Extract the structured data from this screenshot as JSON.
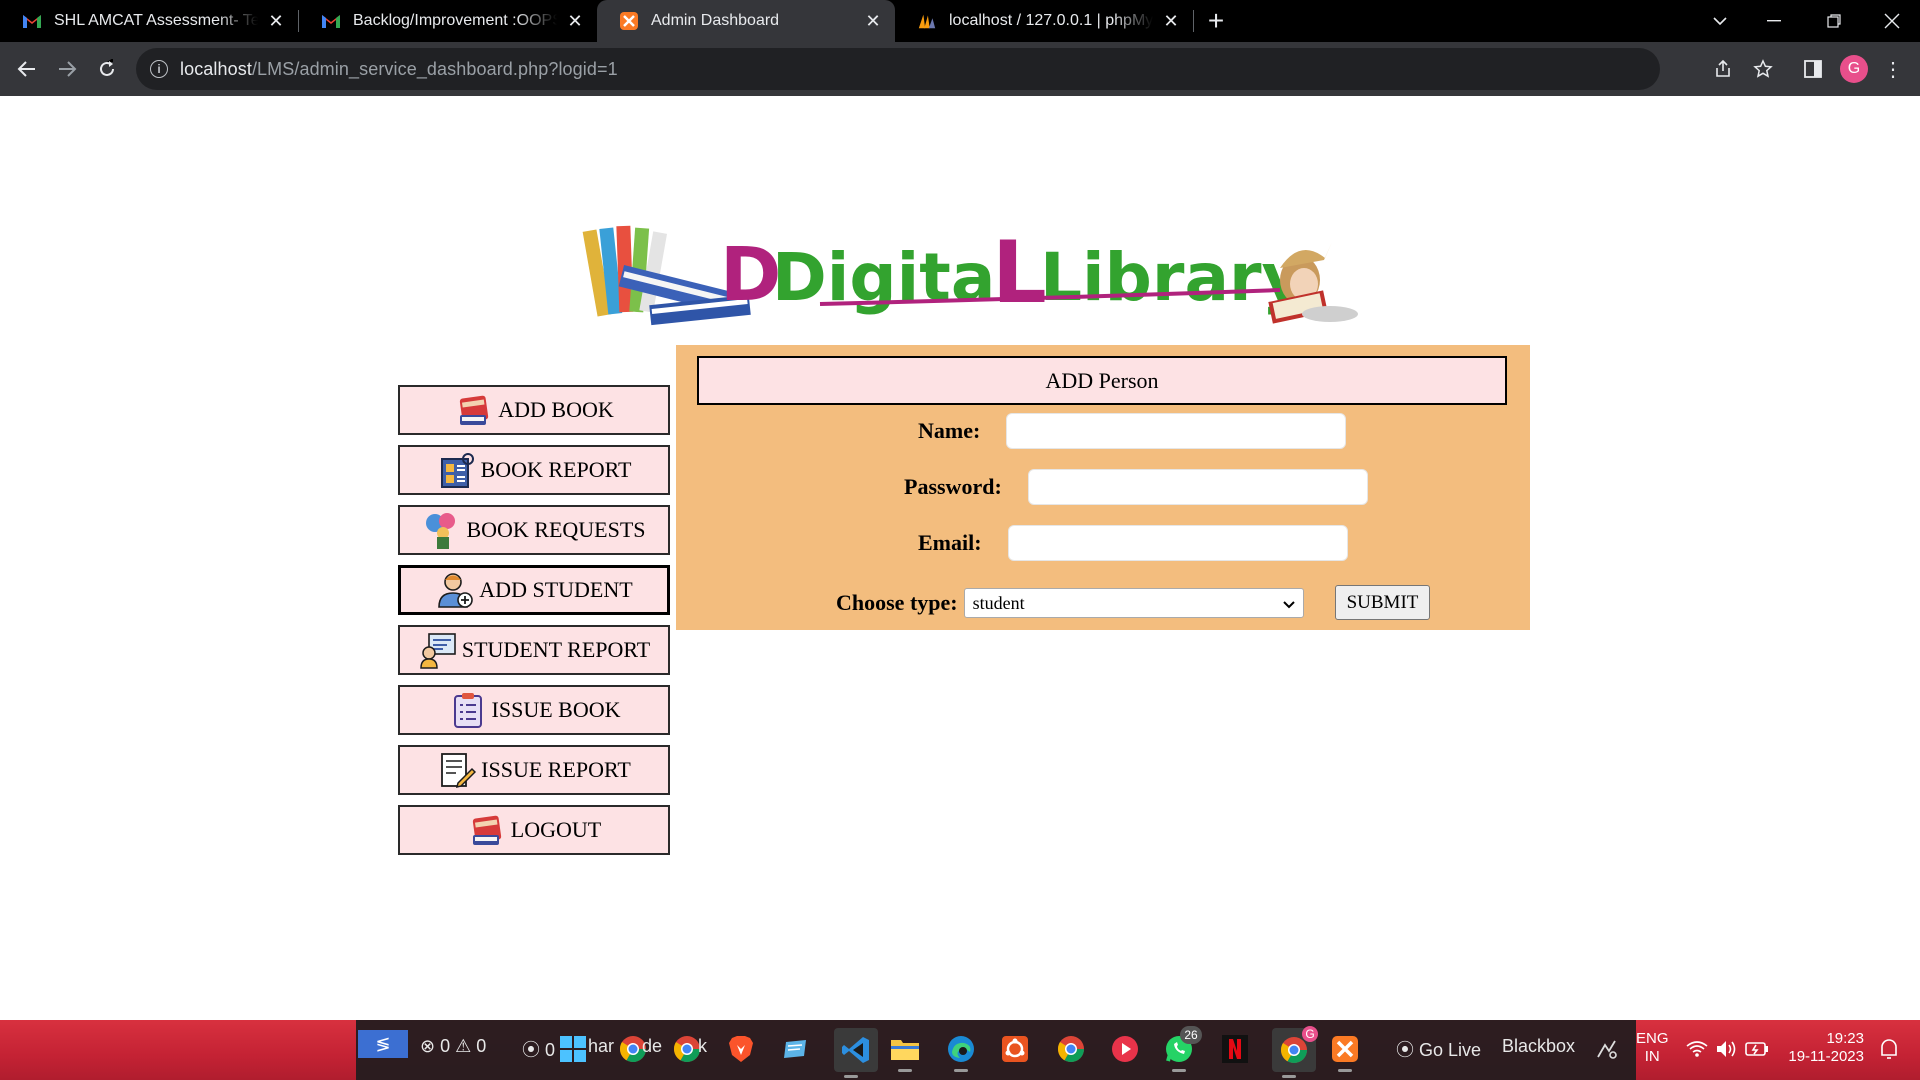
{
  "browser": {
    "tabs": [
      {
        "title": "SHL AMCAT Assessment- Test Lo",
        "icon": "gmail-icon",
        "active": false
      },
      {
        "title": "Backlog/Improvement :OOPS - 2",
        "icon": "gmail-icon",
        "active": false
      },
      {
        "title": "Admin Dashboard",
        "icon": "xampp-icon",
        "active": true
      },
      {
        "title": "localhost / 127.0.0.1 | phpMyAd",
        "icon": "phpmyadmin-icon",
        "active": false
      }
    ],
    "url_host": "localhost",
    "url_path": "/LMS/admin_service_dashboard.php?logid=1",
    "profile_initial": "G"
  },
  "logo": {
    "word1": "Digital",
    "word2": "Library"
  },
  "menu": [
    {
      "label": "ADD BOOK",
      "icon": "book-stack-icon"
    },
    {
      "label": "BOOK REPORT",
      "icon": "report-icon"
    },
    {
      "label": "BOOK REQUESTS",
      "icon": "request-icon"
    },
    {
      "label": "ADD STUDENT",
      "icon": "add-user-icon"
    },
    {
      "label": "STUDENT REPORT",
      "icon": "student-report-icon"
    },
    {
      "label": "ISSUE BOOK",
      "icon": "clipboard-icon"
    },
    {
      "label": "ISSUE REPORT",
      "icon": "issue-report-icon"
    },
    {
      "label": "LOGOUT",
      "icon": "logout-book-icon"
    }
  ],
  "form": {
    "title": "ADD Person",
    "name_label": "Name:",
    "name_value": "",
    "password_label": "Password:",
    "password_value": "",
    "email_label": "Email:",
    "email_value": "",
    "type_label": "Choose type:",
    "type_selected": "student",
    "submit_label": "SUBMIT"
  },
  "taskbar": {
    "problems_errors": "0",
    "problems_warnings": "0",
    "ports": "0",
    "ghost_text": "har",
    "ghost_text2": "de",
    "ghost_text3": "k",
    "whatsapp_badge": "26",
    "chrome_badge": "G",
    "go_live": "Go Live",
    "blackbox": "Blackbox",
    "lang1": "ENG",
    "lang2": "IN",
    "time": "19:23",
    "date": "19-11-2023"
  }
}
